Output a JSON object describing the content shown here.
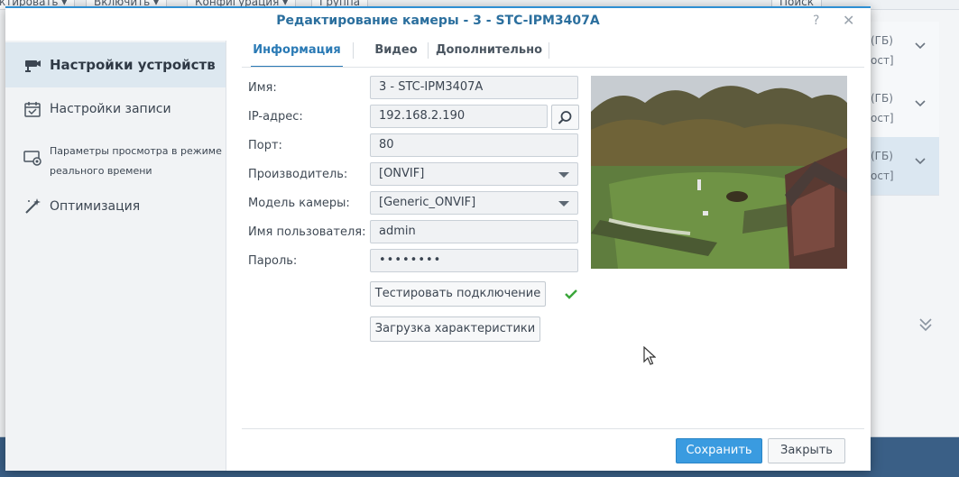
{
  "background": {
    "toolbar": [
      "ктировать ▾",
      "Включить ▾",
      "Конфигурация ▾",
      "Группа",
      "Поиск"
    ],
    "rows": [
      {
        "line1": "(ГБ)",
        "line2": "ост]"
      },
      {
        "line1": "(ГБ)",
        "line2": "ост]"
      },
      {
        "line1": "(ГБ)",
        "line2": "ост]"
      }
    ]
  },
  "dialog": {
    "title": "Редактирование камеры - 3 - STC-IPM3407A",
    "help": "?",
    "close": "✕"
  },
  "sidebar": {
    "items": [
      {
        "label": "Настройки устройств",
        "icon": "camera-icon"
      },
      {
        "label": "Настройки записи",
        "icon": "calendar-icon"
      },
      {
        "label_line1": "Параметры просмотра в режиме",
        "label_line2": "реального времени",
        "icon": "monitor-icon"
      },
      {
        "label": "Оптимизация",
        "icon": "wand-icon"
      }
    ]
  },
  "tabs": [
    "Информация",
    "Видео",
    "Дополнительно"
  ],
  "form": {
    "name_label": "Имя:",
    "name_value": "3 - STC-IPM3407A",
    "ip_label": "IP-адрес:",
    "ip_value": "192.168.2.190",
    "port_label": "Порт:",
    "port_value": "80",
    "vendor_label": "Производитель:",
    "vendor_value": "[ONVIF]",
    "model_label": "Модель камеры:",
    "model_value": "[Generic_ONVIF]",
    "user_label": "Имя пользователя:",
    "user_value": "admin",
    "password_label": "Пароль:",
    "password_value": "••••••••"
  },
  "buttons": {
    "test": "Тестировать подключение",
    "load": "Загрузка характеристики",
    "save": "Сохранить",
    "close": "Закрыть"
  },
  "colors": {
    "accent": "#2a7ab5",
    "primary_button": "#3a9be0",
    "success": "#3aa63a"
  }
}
